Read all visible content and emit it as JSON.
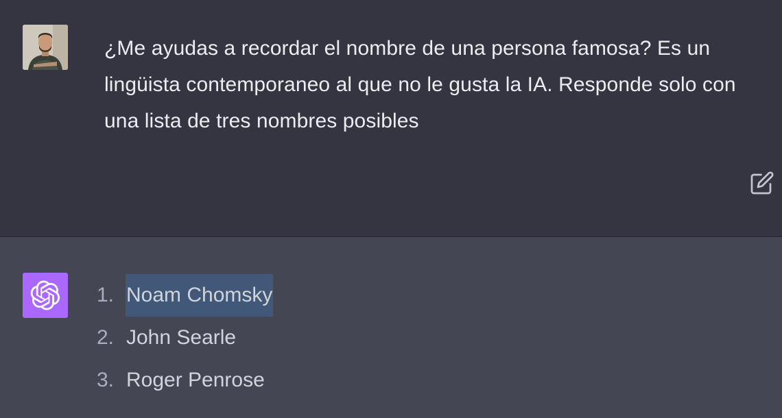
{
  "user_message": {
    "text": "¿Me ayudas a recordar el nombre de una persona famosa? Es un lingüista contemporaneo al que no le gusta la IA. Responde solo con una lista de tres nombres posibles",
    "avatar": "user-photo-avatar",
    "edit_icon": "edit-icon"
  },
  "assistant_message": {
    "avatar": "chatgpt-logo-icon",
    "items": [
      {
        "number": "1.",
        "name": "Noam Chomsky",
        "selected": true
      },
      {
        "number": "2.",
        "name": "John Searle",
        "selected": false
      },
      {
        "number": "3.",
        "name": "Roger Penrose",
        "selected": false
      }
    ]
  },
  "colors": {
    "user_bg": "#343541",
    "assistant_bg": "#444654",
    "gpt_avatar": "#ab68ff",
    "selection": "#425879",
    "text": "#ececf1"
  }
}
